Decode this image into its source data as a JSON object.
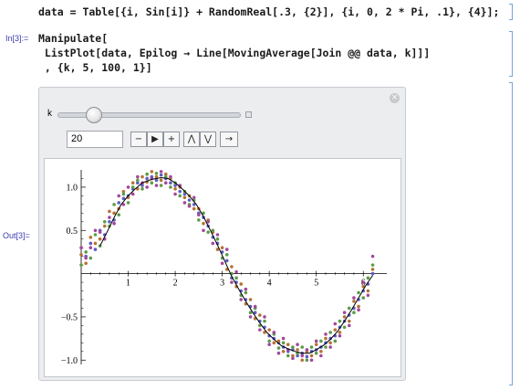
{
  "notebook": {
    "line1": "data = Table[{i, Sin[i]} + RandomReal[.3, {2}], {i, 0, 2 * Pi, .1}, {4}];",
    "input_label": "In[3]:=",
    "input_line1": "Manipulate[",
    "input_line2": " ListPlot[data, Epilog → Line[MovingAverage[Join @@ data, k]]]",
    "input_line3": " , {k, 5, 100, 1}]",
    "output_label": "Out[3]="
  },
  "manipulate": {
    "control_label": "k",
    "value": "20",
    "slider": {
      "min": 5,
      "max": 100,
      "value": 20
    },
    "buttons": {
      "minus": "−",
      "play": "▶",
      "plus": "+",
      "faster": "⋀",
      "slower": "⋁",
      "direction": "→"
    },
    "close_icon": "close-icon"
  },
  "chart_data": {
    "type": "scatter",
    "xlim": [
      0,
      6.5
    ],
    "ylim": [
      -1.05,
      1.2
    ],
    "xticks": [
      1,
      2,
      3,
      4,
      5,
      6
    ],
    "yticks": [
      -1.0,
      -0.5,
      0.5,
      1.0
    ],
    "xtick_labels": [
      "1",
      "2",
      "3",
      "4",
      "5",
      "6"
    ],
    "ytick_labels": [
      "−1.0",
      "−0.5",
      "0.5",
      "1.0"
    ],
    "series_colors": [
      "#5d5cc5",
      "#b57234",
      "#5d9b47",
      "#a3479c"
    ],
    "series": [
      {
        "values": [
          [
            0.1,
            0.2
          ],
          [
            0.2,
            0.35
          ],
          [
            0.3,
            0.28
          ],
          [
            0.4,
            0.5
          ],
          [
            0.5,
            0.45
          ],
          [
            0.6,
            0.6
          ],
          [
            0.7,
            0.62
          ],
          [
            0.8,
            0.82
          ],
          [
            0.9,
            0.87
          ],
          [
            1.0,
            0.9
          ],
          [
            1.1,
            0.98
          ],
          [
            1.2,
            1.05
          ],
          [
            1.3,
            1.02
          ],
          [
            1.4,
            1.1
          ],
          [
            1.5,
            1.12
          ],
          [
            1.6,
            1.08
          ],
          [
            1.7,
            1.14
          ],
          [
            1.8,
            1.1
          ],
          [
            1.9,
            1.05
          ],
          [
            2.0,
            1.02
          ],
          [
            2.1,
            0.95
          ],
          [
            2.2,
            0.92
          ],
          [
            2.3,
            0.85
          ],
          [
            2.4,
            0.8
          ],
          [
            2.5,
            0.7
          ],
          [
            2.6,
            0.65
          ],
          [
            2.7,
            0.55
          ],
          [
            2.8,
            0.42
          ],
          [
            2.9,
            0.35
          ],
          [
            3.0,
            0.25
          ],
          [
            3.1,
            0.15
          ],
          [
            3.2,
            -0.05
          ],
          [
            3.3,
            -0.1
          ],
          [
            3.4,
            -0.2
          ],
          [
            3.5,
            -0.3
          ],
          [
            3.6,
            -0.38
          ],
          [
            3.7,
            -0.45
          ],
          [
            3.8,
            -0.55
          ],
          [
            3.9,
            -0.62
          ],
          [
            4.0,
            -0.72
          ],
          [
            4.1,
            -0.75
          ],
          [
            4.2,
            -0.8
          ],
          [
            4.3,
            -0.85
          ],
          [
            4.4,
            -0.9
          ],
          [
            4.5,
            -0.88
          ],
          [
            4.6,
            -0.95
          ],
          [
            4.7,
            -0.92
          ],
          [
            4.8,
            -0.96
          ],
          [
            4.9,
            -0.9
          ],
          [
            5.0,
            -0.88
          ],
          [
            5.1,
            -0.85
          ],
          [
            5.2,
            -0.8
          ],
          [
            5.3,
            -0.75
          ],
          [
            5.4,
            -0.72
          ],
          [
            5.5,
            -0.62
          ],
          [
            5.6,
            -0.55
          ],
          [
            5.7,
            -0.48
          ],
          [
            5.8,
            -0.4
          ],
          [
            5.9,
            -0.3
          ],
          [
            6.0,
            -0.2
          ],
          [
            6.1,
            -0.12
          ],
          [
            6.2,
            0.0
          ]
        ]
      },
      {
        "values": [
          [
            0.0,
            0.22
          ],
          [
            0.1,
            0.12
          ],
          [
            0.2,
            0.42
          ],
          [
            0.3,
            0.35
          ],
          [
            0.4,
            0.4
          ],
          [
            0.5,
            0.55
          ],
          [
            0.6,
            0.72
          ],
          [
            0.7,
            0.7
          ],
          [
            0.8,
            0.75
          ],
          [
            0.9,
            0.95
          ],
          [
            1.0,
            0.88
          ],
          [
            1.1,
            1.05
          ],
          [
            1.2,
            0.98
          ],
          [
            1.3,
            1.12
          ],
          [
            1.4,
            1.06
          ],
          [
            1.5,
            1.18
          ],
          [
            1.6,
            1.12
          ],
          [
            1.7,
            1.08
          ],
          [
            1.8,
            1.15
          ],
          [
            1.9,
            1.1
          ],
          [
            2.0,
            0.98
          ],
          [
            2.1,
            1.0
          ],
          [
            2.2,
            0.88
          ],
          [
            2.3,
            0.9
          ],
          [
            2.4,
            0.75
          ],
          [
            2.5,
            0.75
          ],
          [
            2.6,
            0.58
          ],
          [
            2.7,
            0.62
          ],
          [
            2.8,
            0.48
          ],
          [
            2.9,
            0.28
          ],
          [
            3.0,
            0.3
          ],
          [
            3.1,
            0.05
          ],
          [
            3.2,
            0.08
          ],
          [
            3.3,
            -0.15
          ],
          [
            3.4,
            -0.12
          ],
          [
            3.5,
            -0.35
          ],
          [
            3.6,
            -0.3
          ],
          [
            3.7,
            -0.52
          ],
          [
            3.8,
            -0.48
          ],
          [
            3.9,
            -0.68
          ],
          [
            4.0,
            -0.65
          ],
          [
            4.1,
            -0.8
          ],
          [
            4.2,
            -0.78
          ],
          [
            4.3,
            -0.9
          ],
          [
            4.4,
            -0.82
          ],
          [
            4.5,
            -0.95
          ],
          [
            4.6,
            -0.88
          ],
          [
            4.7,
            -1.0
          ],
          [
            4.8,
            -0.9
          ],
          [
            4.9,
            -0.95
          ],
          [
            5.0,
            -0.82
          ],
          [
            5.1,
            -0.9
          ],
          [
            5.2,
            -0.75
          ],
          [
            5.3,
            -0.8
          ],
          [
            5.4,
            -0.65
          ],
          [
            5.5,
            -0.68
          ],
          [
            5.6,
            -0.5
          ],
          [
            5.7,
            -0.55
          ],
          [
            5.8,
            -0.32
          ],
          [
            5.9,
            -0.38
          ],
          [
            6.0,
            -0.15
          ],
          [
            6.1,
            -0.2
          ],
          [
            6.2,
            0.05
          ]
        ]
      },
      {
        "values": [
          [
            0.0,
            0.1
          ],
          [
            0.1,
            0.25
          ],
          [
            0.2,
            0.18
          ],
          [
            0.3,
            0.45
          ],
          [
            0.4,
            0.32
          ],
          [
            0.5,
            0.6
          ],
          [
            0.6,
            0.55
          ],
          [
            0.7,
            0.8
          ],
          [
            0.8,
            0.68
          ],
          [
            0.9,
            0.92
          ],
          [
            1.0,
            0.82
          ],
          [
            1.1,
            1.0
          ],
          [
            1.2,
            1.08
          ],
          [
            1.3,
            0.98
          ],
          [
            1.4,
            1.15
          ],
          [
            1.5,
            1.05
          ],
          [
            1.6,
            1.16
          ],
          [
            1.7,
            1.02
          ],
          [
            1.8,
            1.12
          ],
          [
            1.9,
            1.0
          ],
          [
            2.0,
            1.05
          ],
          [
            2.1,
            0.9
          ],
          [
            2.2,
            0.95
          ],
          [
            2.3,
            0.8
          ],
          [
            2.4,
            0.85
          ],
          [
            2.5,
            0.62
          ],
          [
            2.6,
            0.7
          ],
          [
            2.7,
            0.48
          ],
          [
            2.8,
            0.5
          ],
          [
            2.9,
            0.4
          ],
          [
            3.0,
            0.18
          ],
          [
            3.1,
            0.22
          ],
          [
            3.2,
            0.0
          ],
          [
            3.3,
            -0.05
          ],
          [
            3.4,
            -0.25
          ],
          [
            3.5,
            -0.22
          ],
          [
            3.6,
            -0.45
          ],
          [
            3.7,
            -0.4
          ],
          [
            3.8,
            -0.6
          ],
          [
            3.9,
            -0.55
          ],
          [
            4.0,
            -0.78
          ],
          [
            4.1,
            -0.7
          ],
          [
            4.2,
            -0.86
          ],
          [
            4.3,
            -0.8
          ],
          [
            4.4,
            -0.95
          ],
          [
            4.5,
            -0.85
          ],
          [
            4.6,
            -0.92
          ],
          [
            4.7,
            -0.85
          ],
          [
            4.8,
            -1.0
          ],
          [
            4.9,
            -0.85
          ],
          [
            5.0,
            -0.92
          ],
          [
            5.1,
            -0.78
          ],
          [
            5.2,
            -0.85
          ],
          [
            5.3,
            -0.68
          ],
          [
            5.4,
            -0.78
          ],
          [
            5.5,
            -0.55
          ],
          [
            5.6,
            -0.62
          ],
          [
            5.7,
            -0.4
          ],
          [
            5.8,
            -0.45
          ],
          [
            5.9,
            -0.22
          ],
          [
            6.0,
            -0.28
          ],
          [
            6.1,
            -0.05
          ],
          [
            6.2,
            0.1
          ]
        ]
      },
      {
        "values": [
          [
            0.0,
            0.3
          ],
          [
            0.1,
            0.18
          ],
          [
            0.2,
            0.3
          ],
          [
            0.3,
            0.5
          ],
          [
            0.4,
            0.48
          ],
          [
            0.5,
            0.4
          ],
          [
            0.6,
            0.65
          ],
          [
            0.7,
            0.58
          ],
          [
            0.8,
            0.9
          ],
          [
            0.9,
            0.8
          ],
          [
            1.0,
            1.0
          ],
          [
            1.1,
            0.92
          ],
          [
            1.2,
            1.12
          ],
          [
            1.3,
            1.05
          ],
          [
            1.4,
            1.0
          ],
          [
            1.5,
            1.1
          ],
          [
            1.6,
            1.02
          ],
          [
            1.7,
            1.18
          ],
          [
            1.8,
            1.05
          ],
          [
            1.9,
            1.12
          ],
          [
            2.0,
            0.92
          ],
          [
            2.1,
            1.02
          ],
          [
            2.2,
            0.82
          ],
          [
            2.3,
            0.78
          ],
          [
            2.4,
            0.88
          ],
          [
            2.5,
            0.68
          ],
          [
            2.6,
            0.5
          ],
          [
            2.7,
            0.6
          ],
          [
            2.8,
            0.35
          ],
          [
            2.9,
            0.45
          ],
          [
            3.0,
            0.12
          ],
          [
            3.1,
            0.28
          ],
          [
            3.2,
            -0.1
          ],
          [
            3.3,
            0.02
          ],
          [
            3.4,
            -0.3
          ],
          [
            3.5,
            -0.18
          ],
          [
            3.6,
            -0.5
          ],
          [
            3.7,
            -0.38
          ],
          [
            3.8,
            -0.65
          ],
          [
            3.9,
            -0.5
          ],
          [
            4.0,
            -0.82
          ],
          [
            4.1,
            -0.68
          ],
          [
            4.2,
            -0.92
          ],
          [
            4.3,
            -0.75
          ],
          [
            4.4,
            -0.88
          ],
          [
            4.5,
            -0.98
          ],
          [
            4.6,
            -0.82
          ],
          [
            4.7,
            -0.95
          ],
          [
            4.8,
            -0.88
          ],
          [
            4.9,
            -1.0
          ],
          [
            5.0,
            -0.78
          ],
          [
            5.1,
            -0.95
          ],
          [
            5.2,
            -0.7
          ],
          [
            5.3,
            -0.85
          ],
          [
            5.4,
            -0.58
          ],
          [
            5.5,
            -0.72
          ],
          [
            5.6,
            -0.45
          ],
          [
            5.7,
            -0.6
          ],
          [
            5.8,
            -0.28
          ],
          [
            5.9,
            -0.42
          ],
          [
            6.0,
            -0.1
          ],
          [
            6.1,
            -0.25
          ],
          [
            6.2,
            0.2
          ]
        ]
      }
    ],
    "moving_average": [
      [
        0.4,
        0.32
      ],
      [
        0.55,
        0.48
      ],
      [
        0.7,
        0.65
      ],
      [
        0.85,
        0.8
      ],
      [
        1.0,
        0.9
      ],
      [
        1.15,
        0.98
      ],
      [
        1.3,
        1.05
      ],
      [
        1.5,
        1.09
      ],
      [
        1.7,
        1.11
      ],
      [
        1.85,
        1.1
      ],
      [
        2.0,
        1.05
      ],
      [
        2.15,
        0.98
      ],
      [
        2.3,
        0.9
      ],
      [
        2.45,
        0.8
      ],
      [
        2.6,
        0.66
      ],
      [
        2.75,
        0.5
      ],
      [
        2.9,
        0.33
      ],
      [
        3.05,
        0.15
      ],
      [
        3.2,
        -0.03
      ],
      [
        3.35,
        -0.18
      ],
      [
        3.5,
        -0.32
      ],
      [
        3.65,
        -0.45
      ],
      [
        3.8,
        -0.57
      ],
      [
        3.95,
        -0.68
      ],
      [
        4.1,
        -0.76
      ],
      [
        4.25,
        -0.83
      ],
      [
        4.4,
        -0.87
      ],
      [
        4.55,
        -0.9
      ],
      [
        4.7,
        -0.92
      ],
      [
        4.85,
        -0.92
      ],
      [
        5.0,
        -0.88
      ],
      [
        5.15,
        -0.83
      ],
      [
        5.3,
        -0.76
      ],
      [
        5.45,
        -0.67
      ],
      [
        5.6,
        -0.55
      ],
      [
        5.75,
        -0.42
      ],
      [
        5.9,
        -0.28
      ],
      [
        6.05,
        -0.14
      ],
      [
        6.2,
        -0.02
      ]
    ]
  }
}
